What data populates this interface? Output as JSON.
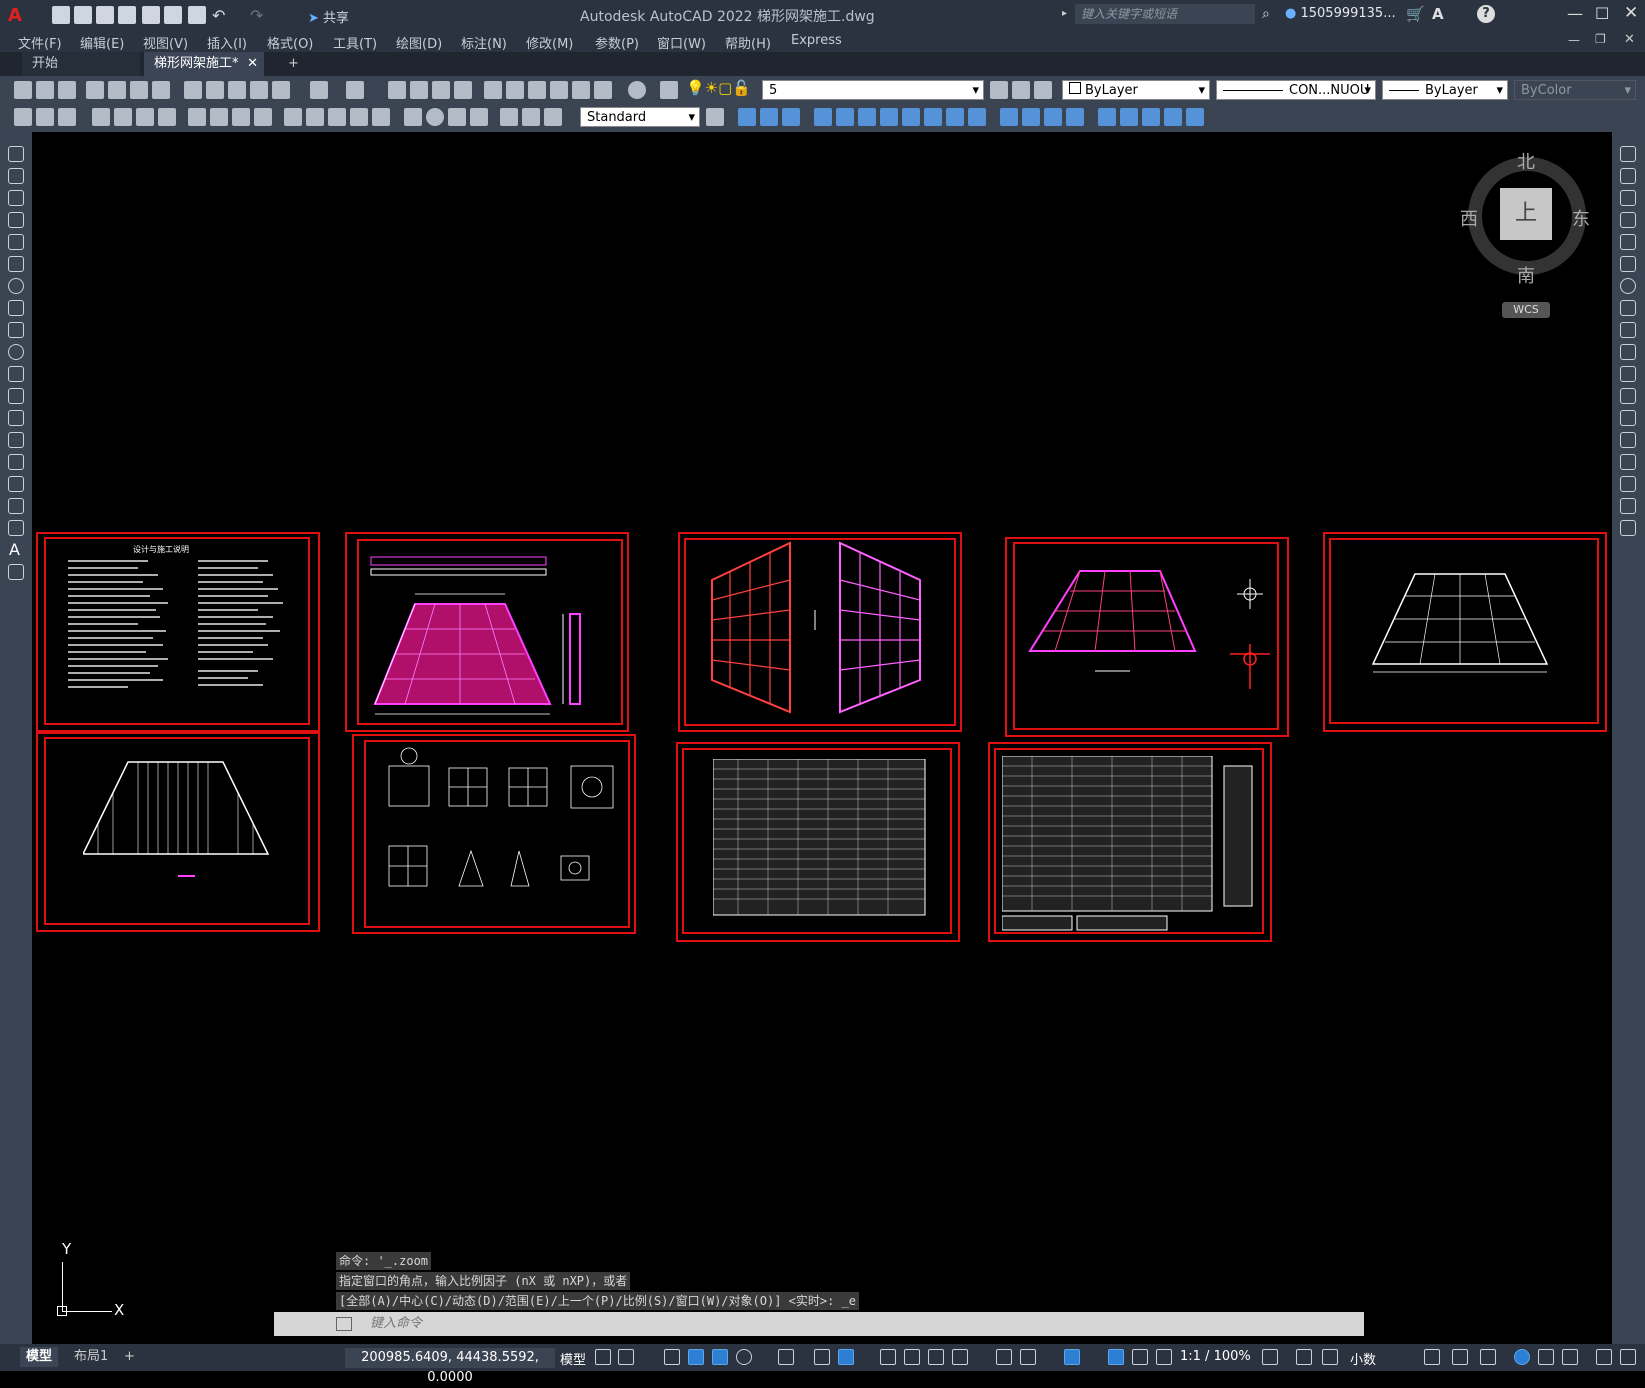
{
  "window": {
    "app_title": "Autodesk AutoCAD 2022    梯形网架施工.dwg",
    "share_label": "共享",
    "search_placeholder": "键入关键字或短语",
    "user": "1505999135..."
  },
  "menu": [
    "文件(F)",
    "编辑(E)",
    "视图(V)",
    "插入(I)",
    "格式(O)",
    "工具(T)",
    "绘图(D)",
    "标注(N)",
    "修改(M)",
    "参数(P)",
    "窗口(W)",
    "帮助(H)",
    "Express"
  ],
  "tabs": {
    "start": "开始",
    "file": "梯形网架施工*",
    "add": "+"
  },
  "toolbar": {
    "layer": "5",
    "color": "ByLayer",
    "linetype": "CON...NUOU",
    "lineweight": "ByLayer",
    "plotstyle": "ByColor",
    "textstyle": "Standard"
  },
  "viewcube": {
    "north": "北",
    "south": "南",
    "east": "东",
    "west": "西",
    "top": "上",
    "wcs": "WCS"
  },
  "sheets": {
    "notes_title": "设计与施工说明"
  },
  "command": {
    "history": [
      "命令: '_.zoom",
      "指定窗口的角点，输入比例因子 (nX 或 nXP)，或者",
      "[全部(A)/中心(C)/动态(D)/范围(E)/上一个(P)/比例(S)/窗口(W)/对象(O)] <实时>: _e"
    ],
    "placeholder": "键入命令"
  },
  "status": {
    "model_tab": "模型",
    "layout_tab": "布局1",
    "add": "+",
    "coords": "200985.6409, 44438.5592, 0.0000",
    "space": "模型",
    "scale": "1:1 / 100%",
    "units": "小数"
  },
  "ucs": {
    "x": "X",
    "y": "Y"
  }
}
